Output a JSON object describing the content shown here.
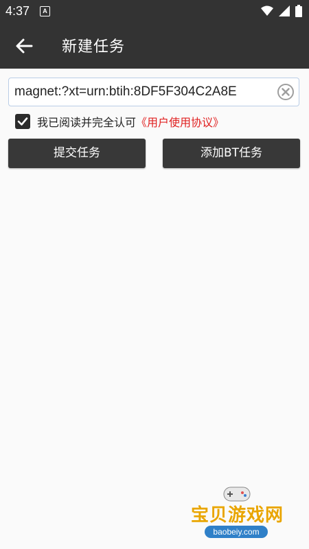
{
  "status_bar": {
    "time": "4:37",
    "notification_letter": "A"
  },
  "app_bar": {
    "title": "新建任务"
  },
  "magnet_input": {
    "value": "magnet:?xt=urn:btih:8DF5F304C2A8E"
  },
  "agreement": {
    "checked": true,
    "text": "我已阅读并完全认可",
    "link_text": "《用户使用协议》",
    "link_color": "#e02020"
  },
  "buttons": {
    "submit_label": "提交任务",
    "add_bt_label": "添加BT任务"
  },
  "watermark": {
    "text": "宝贝游戏网",
    "url": "baobeiy.com"
  },
  "colors": {
    "app_bar": "#333333",
    "background": "#fafafa",
    "button": "#383838"
  }
}
